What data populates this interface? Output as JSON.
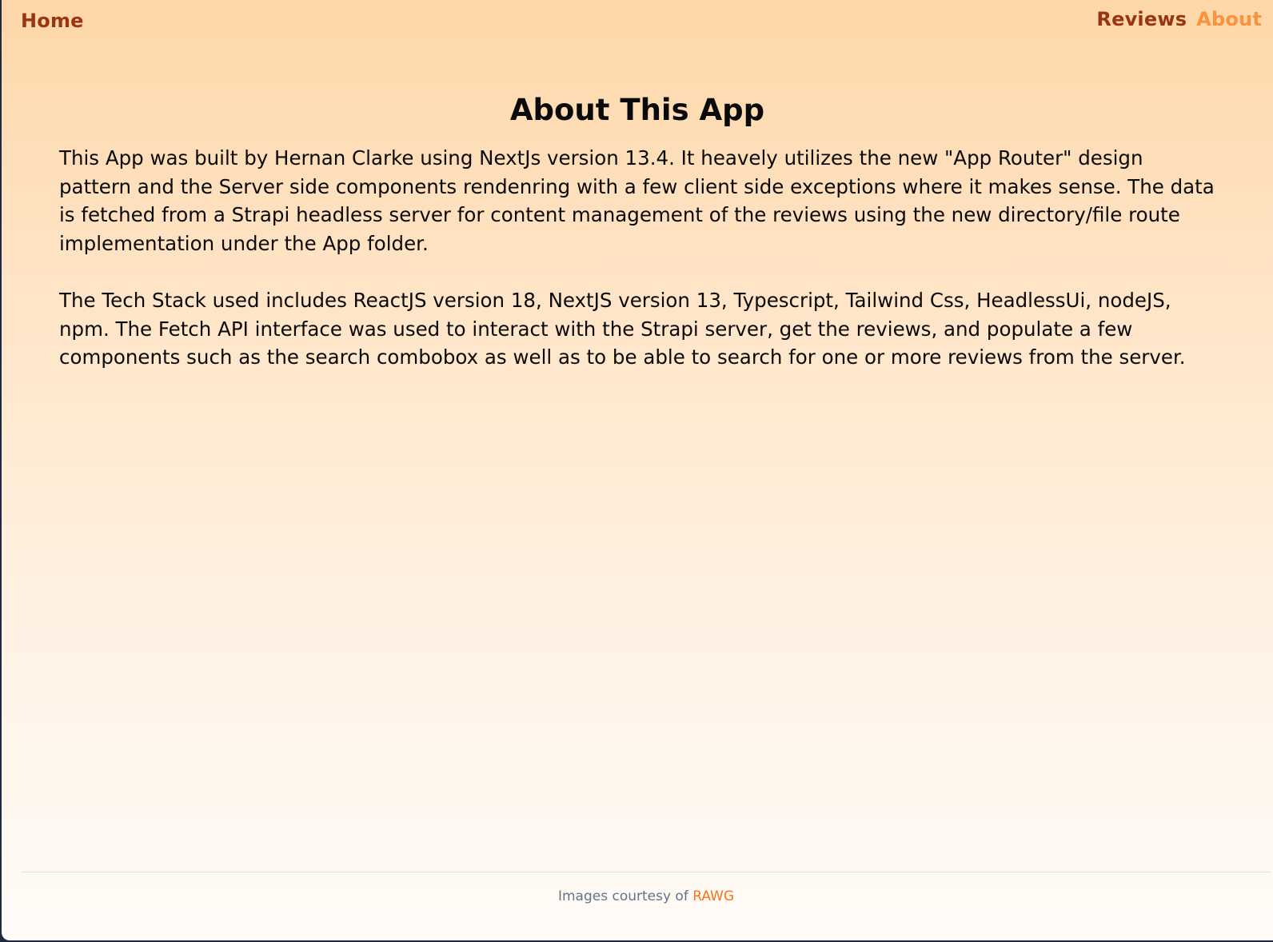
{
  "nav": {
    "home": "Home",
    "reviews": "Reviews",
    "about": "About"
  },
  "main": {
    "title": "About This App",
    "paragraphs": [
      "This App was built by Hernan Clarke using NextJs version 13.4. It heavely utilizes the new \"App Router\" design pattern and the Server side components rendenring with a few client side exceptions where it makes sense. The data is fetched from a Strapi headless server for content management of the reviews using the new directory/file route implementation under the App folder.",
      "The Tech Stack used includes ReactJS version 18, NextJS version 13, Typescript, Tailwind Css, HeadlessUi, nodeJS, npm. The Fetch API interface was used to interact with the Strapi server, get the reviews, and populate a few components such as the search combobox as well as to be able to search for one or more reviews from the server."
    ]
  },
  "footer": {
    "text": "Images courtesy of",
    "link": "RAWG"
  },
  "colors": {
    "nav_link": "#9a3412",
    "nav_active": "#fb923c",
    "footer_link": "#f97316",
    "background_top": "#fed7a8",
    "background_bottom": "#fffbf7"
  }
}
